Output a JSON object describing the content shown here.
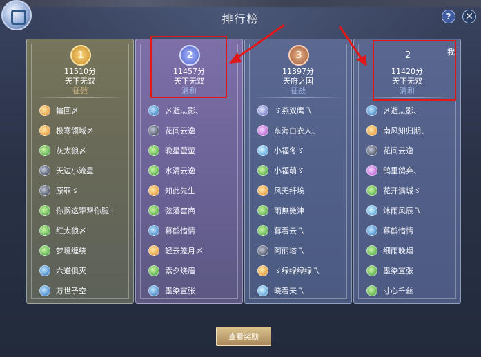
{
  "window": {
    "title": "排行榜"
  },
  "header": {
    "help_label": "?",
    "close_label": "✕"
  },
  "columns": [
    {
      "rank": "1",
      "score": "11510分",
      "server": "天下无双",
      "subtitle": "征戮",
      "players": [
        {
          "icon": "sun-icon",
          "name": "輪回〆"
        },
        {
          "icon": "sun-icon",
          "name": "极寒领域〆"
        },
        {
          "icon": "leaf-icon",
          "name": "灰太狼〆"
        },
        {
          "icon": "moon-icon",
          "name": "天边小流星"
        },
        {
          "icon": "moon-icon",
          "name": "原罪ゞ"
        },
        {
          "icon": "leaf-icon",
          "name": "你搁这犟犟你腿+"
        },
        {
          "icon": "leaf-icon",
          "name": "红太狼〆"
        },
        {
          "icon": "leaf-icon",
          "name": "梦境缠绕"
        },
        {
          "icon": "water-icon",
          "name": "六道俱灭"
        },
        {
          "icon": "water-icon",
          "name": "万世予空"
        }
      ]
    },
    {
      "rank": "2",
      "score": "11457分",
      "server": "天下无双",
      "subtitle": "清和",
      "players": [
        {
          "icon": "water-icon",
          "name": "〆逝灬影、"
        },
        {
          "icon": "moon-icon",
          "name": "花间云逸"
        },
        {
          "icon": "leaf-icon",
          "name": "晚星萤萤"
        },
        {
          "icon": "leaf-icon",
          "name": "水清云逸"
        },
        {
          "icon": "sun-icon",
          "name": "知此先生"
        },
        {
          "icon": "leaf-icon",
          "name": "弦落宫商"
        },
        {
          "icon": "water-icon",
          "name": "慕鹤惜情"
        },
        {
          "icon": "sun-icon",
          "name": "轻云笼月〆"
        },
        {
          "icon": "leaf-icon",
          "name": "素夕烧眉"
        },
        {
          "icon": "water-icon",
          "name": "墨染宣张"
        }
      ]
    },
    {
      "rank": "3",
      "score": "11397分",
      "server": "天府之国",
      "subtitle": "征战",
      "players": [
        {
          "icon": "mist-icon",
          "name": "ゞ燕双鹰乁"
        },
        {
          "icon": "orchid-icon",
          "name": "东海白衣人、"
        },
        {
          "icon": "ice-icon",
          "name": "小福冬ゞ"
        },
        {
          "icon": "leaf-icon",
          "name": "小福萌ゞ"
        },
        {
          "icon": "sun-icon",
          "name": "风无纤埃"
        },
        {
          "icon": "leaf-icon",
          "name": "雨無微津"
        },
        {
          "icon": "leaf-icon",
          "name": "暮看云乁"
        },
        {
          "icon": "moon-icon",
          "name": "阿丽塔乁"
        },
        {
          "icon": "sun-icon",
          "name": "ゞ绿绿绿绿乁"
        },
        {
          "icon": "ice-icon",
          "name": "晓看天乁"
        }
      ]
    },
    {
      "rank": "2",
      "score": "11420分",
      "server": "天下无双",
      "subtitle": "清和",
      "me_label": "我",
      "players": [
        {
          "icon": "water-icon",
          "name": "〆逝灬影、"
        },
        {
          "icon": "sun-icon",
          "name": "南风知归期、"
        },
        {
          "icon": "moon-icon",
          "name": "花间云逸"
        },
        {
          "icon": "orchid-icon",
          "name": "鸽里鸽弃、"
        },
        {
          "icon": "leaf-icon",
          "name": "花开满城ゞ"
        },
        {
          "icon": "ice-icon",
          "name": "沐雨风辰乁"
        },
        {
          "icon": "water-icon",
          "name": "慕鹤惜情"
        },
        {
          "icon": "leaf-icon",
          "name": "细雨晚烟"
        },
        {
          "icon": "leaf-icon",
          "name": "墨染宣张"
        },
        {
          "icon": "leaf-icon",
          "name": "寸心千丝"
        }
      ]
    }
  ],
  "footer": {
    "reward_button": "查看奖励"
  }
}
